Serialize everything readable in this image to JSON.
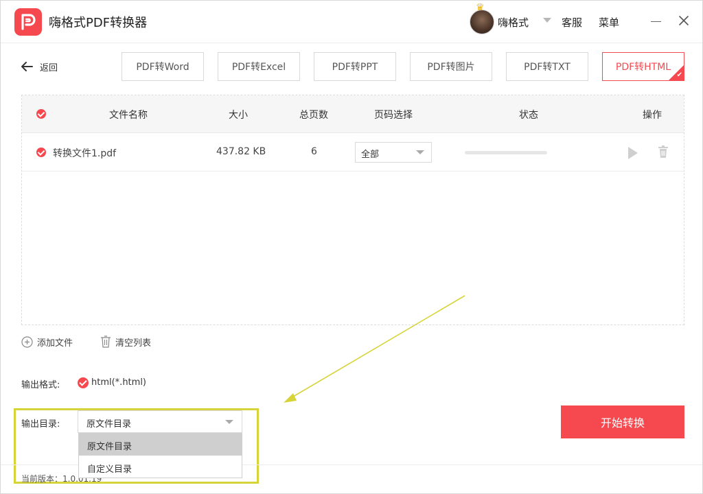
{
  "app": {
    "title": "嗨格式PDF转换器",
    "brand_color": "#f5484f"
  },
  "header": {
    "user_name": "嗨格式",
    "service_label": "客服",
    "menu_label": "菜单"
  },
  "nav": {
    "back_label": "返回",
    "tabs": [
      {
        "label": "PDF转Word",
        "active": false
      },
      {
        "label": "PDF转Excel",
        "active": false
      },
      {
        "label": "PDF转PPT",
        "active": false
      },
      {
        "label": "PDF转图片",
        "active": false
      },
      {
        "label": "PDF转TXT",
        "active": false
      },
      {
        "label": "PDF转HTML",
        "active": true
      }
    ]
  },
  "table": {
    "headers": {
      "name": "文件名称",
      "size": "大小",
      "pages": "总页数",
      "page_select": "页码选择",
      "status": "状态",
      "actions": "操作"
    },
    "rows": [
      {
        "name": "转换文件1.pdf",
        "size": "437.82 KB",
        "pages": "6",
        "page_select": "全部",
        "progress": 0
      }
    ]
  },
  "actions": {
    "add_file": "添加文件",
    "clear_list": "清空列表"
  },
  "output": {
    "format_label": "输出格式:",
    "format_value": "html(*.html)",
    "dir_label": "输出目录:",
    "dir_value": "原文件目录",
    "dir_options": [
      "原文件目录",
      "自定义目录"
    ]
  },
  "start_button": "开始转换",
  "footer": {
    "version": "当前版本：1.0.01.19"
  },
  "annotation": {
    "highlight_color": "#d7d43a"
  }
}
